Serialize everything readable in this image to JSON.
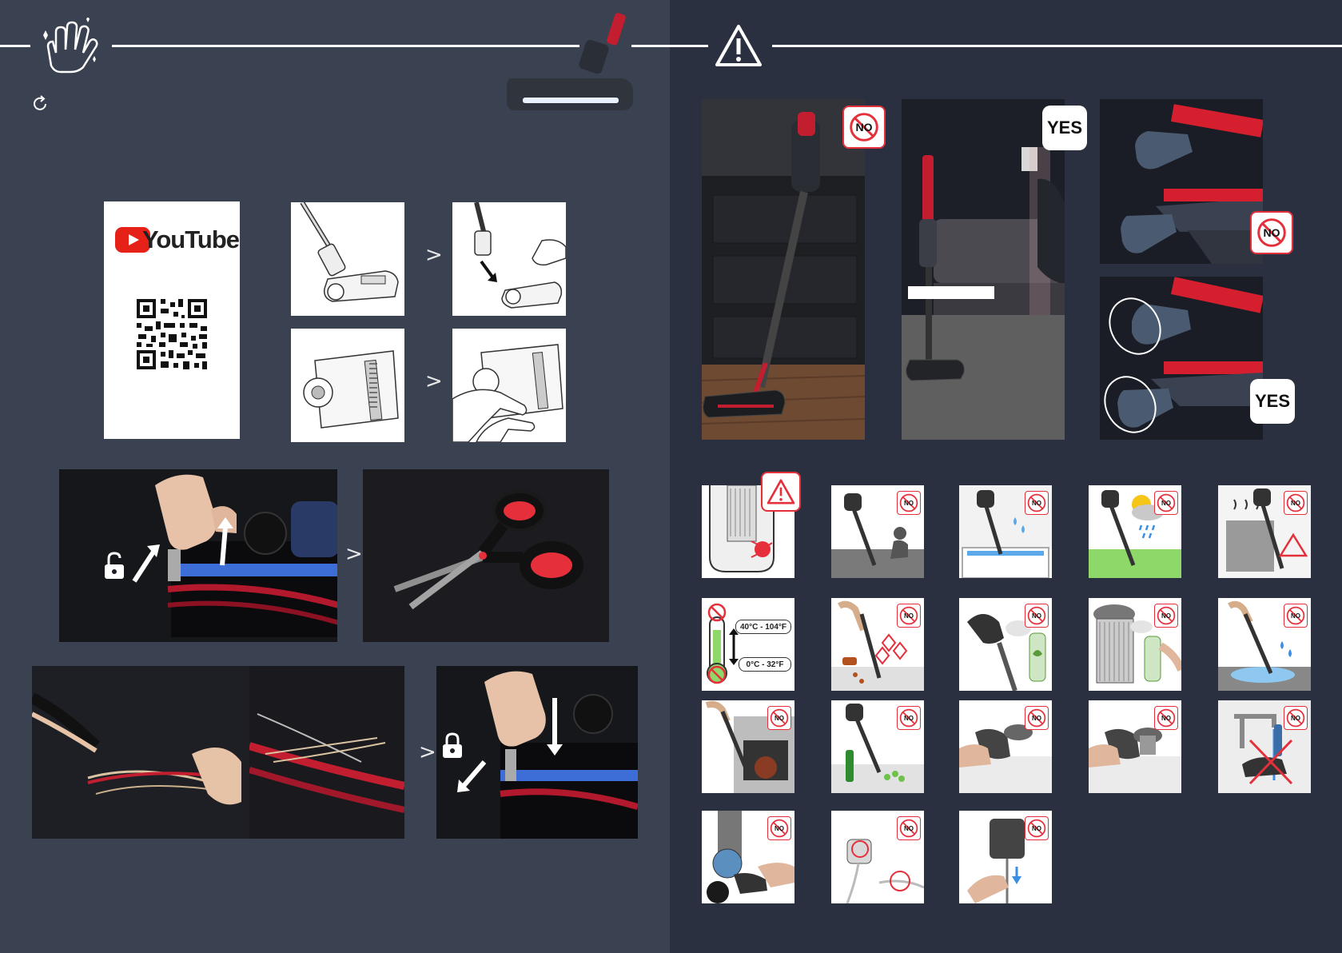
{
  "colors": {
    "left_bg": "#3a4151",
    "right_bg": "#2b3040",
    "accent_red": "#e5303b",
    "no_badge_border": "#e5303b"
  },
  "left_page": {
    "header_icon": "hand-cleaning-icon",
    "refresh_icon": "refresh-icon",
    "youtube_card": {
      "brand": "YouTube",
      "logo_icon": "youtube-play-icon",
      "qr_icon": "qr-code-icon"
    },
    "step_arrows": [
      ">",
      ">",
      ">",
      ">"
    ],
    "icons": {
      "unlock": "unlock-icon",
      "lock": "lock-icon"
    }
  },
  "right_page": {
    "header_icon": "warning-triangle-icon",
    "badges": {
      "no": "NO",
      "yes": "YES"
    },
    "temperature": {
      "high": "40°C - 104°F",
      "low": "0°C - 32°F"
    }
  }
}
